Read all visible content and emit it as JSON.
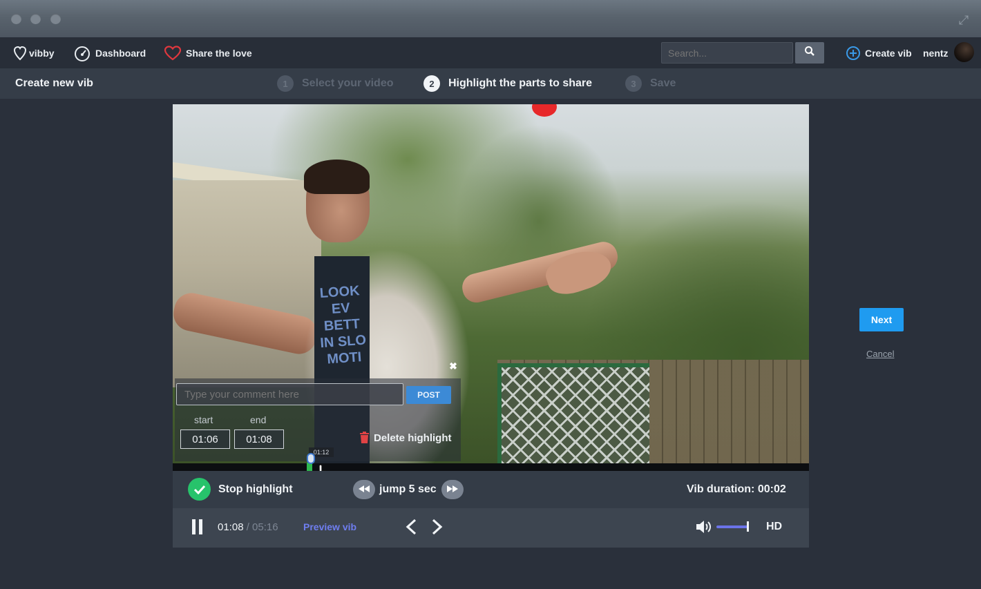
{
  "brand": {
    "name": "vibby"
  },
  "nav": {
    "dashboard_label": "Dashboard",
    "share_label": "Share the love",
    "search_placeholder": "Search...",
    "create_label": "Create vib",
    "username": "nentz"
  },
  "subnav": {
    "title": "Create new vib",
    "steps": [
      {
        "num": "1",
        "label": "Select your video",
        "state": "done"
      },
      {
        "num": "2",
        "label": "Highlight the parts to share",
        "state": "active"
      },
      {
        "num": "3",
        "label": "Save",
        "state": "pending"
      }
    ]
  },
  "video": {
    "shirt_text": "LOOK EV BETT IN SLO MOTI"
  },
  "comment": {
    "placeholder": "Type your comment here",
    "post_label": "POST",
    "close_icon": "close-icon"
  },
  "highlight": {
    "start_label": "start",
    "end_label": "end",
    "start_value": "01:06",
    "end_value": "01:08",
    "delete_label": "Delete highlight",
    "scrub_tooltip": "01:12"
  },
  "controls": {
    "stop_label": "Stop highlight",
    "jump_label": "jump 5 sec",
    "vib_duration": "Vib duration: 00:02",
    "current_time": "01:08",
    "total_time": "/ 05:16",
    "preview_label": "Preview vib",
    "hd_label": "HD",
    "volume_level": 1.0
  },
  "actions": {
    "next_label": "Next",
    "cancel_label": "Cancel"
  },
  "colors": {
    "accent_blue": "#1f9bf0",
    "stop_green": "#27c36b",
    "preview_link": "#6f7ef0",
    "post_blue": "#3c8ad6"
  }
}
